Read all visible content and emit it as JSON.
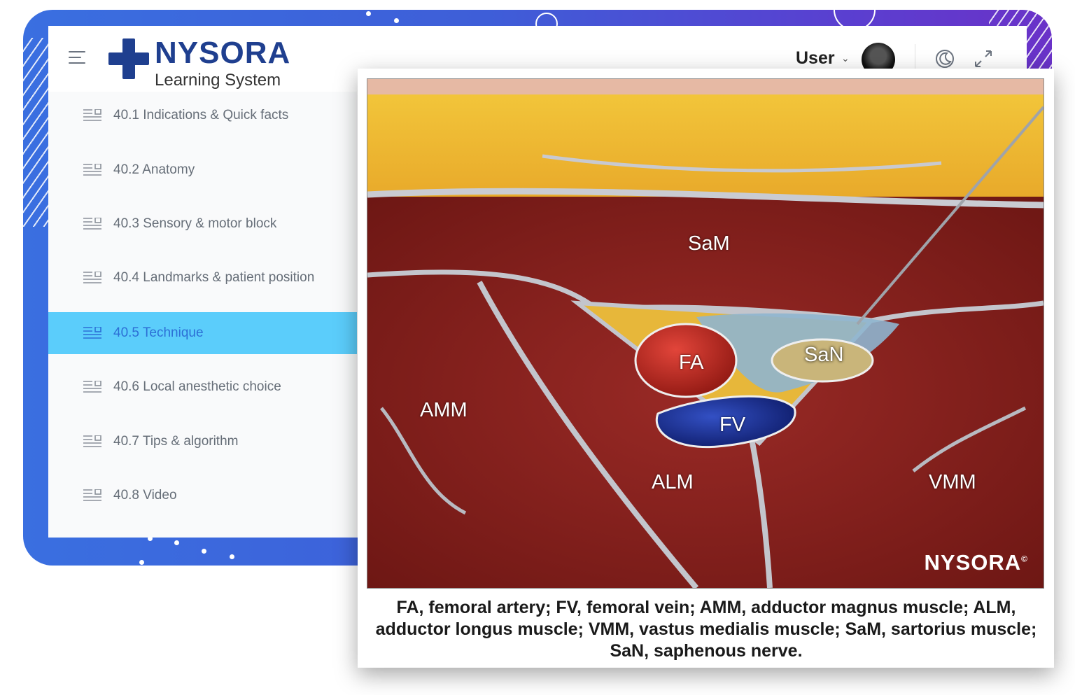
{
  "header": {
    "logo_word": "NYSORA",
    "logo_subtitle": "Learning System",
    "user_label": "User",
    "user_caret": "⌄"
  },
  "sidebar": {
    "items": [
      {
        "label": "40.1 Indications & Quick facts",
        "active": false
      },
      {
        "label": "40.2 Anatomy",
        "active": false
      },
      {
        "label": "40.3 Sensory & motor block",
        "active": false
      },
      {
        "label": "40.4 Landmarks & patient position",
        "active": false
      },
      {
        "label": "40.5 Technique",
        "active": true
      },
      {
        "label": "40.6 Local anesthetic choice",
        "active": false
      },
      {
        "label": "40.7 Tips & algorithm",
        "active": false
      },
      {
        "label": "40.8 Video",
        "active": false
      }
    ]
  },
  "figure": {
    "labels": {
      "sam": "SaM",
      "fa": "FA",
      "san": "SaN",
      "amm": "AMM",
      "fv": "FV",
      "alm": "ALM",
      "vmm": "VMM"
    },
    "watermark": "NYSORA",
    "watermark_mark": "©",
    "caption": "FA, femoral artery; FV, femoral vein; AMM, adductor magnus muscle; ALM, adductor longus muscle; VMM, vastus medialis muscle; SaM, sartorius muscle; SaN, saphenous nerve."
  },
  "icons": {
    "menu": "hamburger-icon",
    "theme": "moon-icon",
    "fullscreen": "expand-icon",
    "nav": "list-icon"
  },
  "colors": {
    "brand": "#1f3f8f",
    "active_nav": "#5bcdfb",
    "active_text": "#2c6fd6",
    "backdrop": "#3e5ed8"
  }
}
